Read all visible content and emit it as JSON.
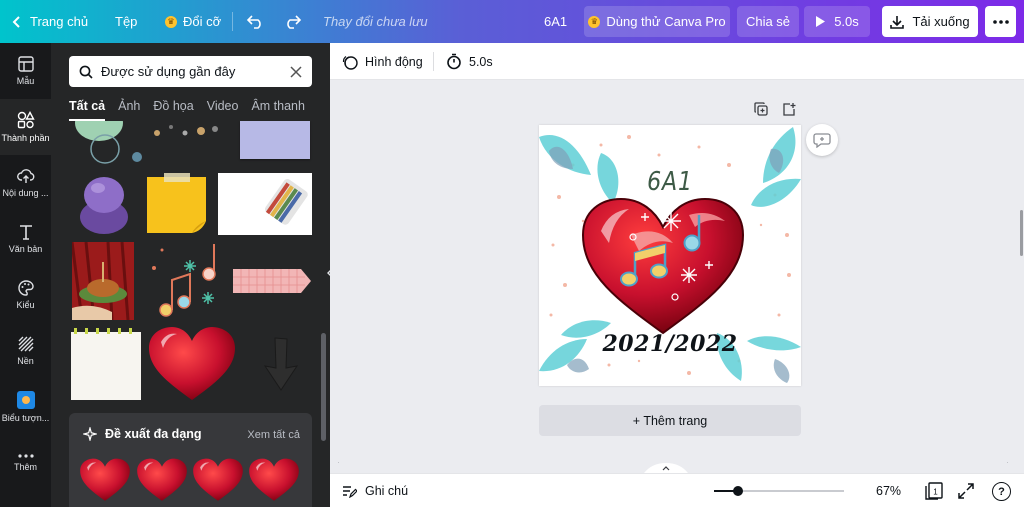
{
  "topbar": {
    "home_label": "Trang chủ",
    "file_label": "Tệp",
    "resize_label": "Đổi cỡ",
    "saved_status": "Thay đổi chưa lưu",
    "design_name": "6A1",
    "pro_label": "Dùng thử Canva Pro",
    "share_label": "Chia sẻ",
    "play_duration": "5.0s",
    "download_label": "Tải xuống"
  },
  "rail": {
    "items": [
      {
        "label": "Mẫu",
        "icon": "template-icon"
      },
      {
        "label": "Thành phần",
        "icon": "elements-icon"
      },
      {
        "label": "Nội dung ...",
        "icon": "upload-icon"
      },
      {
        "label": "Văn bản",
        "icon": "text-icon"
      },
      {
        "label": "Kiểu",
        "icon": "palette-icon"
      },
      {
        "label": "Nền",
        "icon": "background-icon"
      },
      {
        "label": "Biểu tượn...",
        "icon": "logo-icon"
      },
      {
        "label": "Thêm",
        "icon": "more-icon"
      }
    ]
  },
  "panel": {
    "search_value": "Được sử dụng gần đây",
    "tabs": [
      "Tất cả",
      "Ảnh",
      "Đồ họa",
      "Video",
      "Âm thanh"
    ],
    "suggest_title": "Đề xuất đa dạng",
    "suggest_see_all": "Xem tất cả"
  },
  "editor": {
    "animate_label": "Hình động",
    "duration_label": "5.0s",
    "page_title": "6A1",
    "page_year": "2021/2022",
    "add_page_label": "+ Thêm trang"
  },
  "bottombar": {
    "notes_label": "Ghi chú",
    "zoom_percent": "67%",
    "zoom_level": 0.67,
    "page_count": "1"
  },
  "colors": {
    "gradient_start": "#00c4cc",
    "gradient_end": "#7d2ae8",
    "heart_red": "#c8102e",
    "teal_accent": "#5fd0d6"
  }
}
